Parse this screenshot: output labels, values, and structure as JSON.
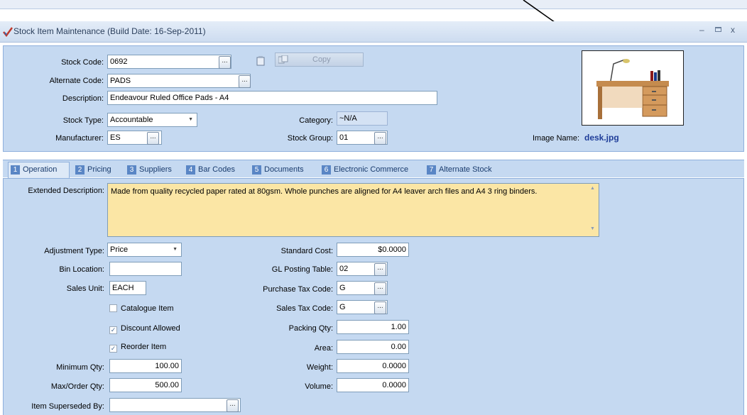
{
  "window": {
    "title": "Stock Item Maintenance (Build Date: 16-Sep-2011)"
  },
  "header": {
    "stock_code_label": "Stock Code:",
    "stock_code": "0692",
    "copy_label": "Copy",
    "alternate_code_label": "Alternate Code:",
    "alternate_code": "PADS",
    "description_label": "Description:",
    "description": "Endeavour Ruled Office Pads - A4",
    "stock_type_label": "Stock Type:",
    "stock_type": "Accountable",
    "category_label": "Category:",
    "category": "~N/A",
    "manufacturer_label": "Manufacturer:",
    "manufacturer": "ES",
    "stock_group_label": "Stock Group:",
    "stock_group": "01",
    "image_name_label": "Image Name:",
    "image_name": "desk.jpg",
    "ellipsis": "..."
  },
  "tabs": [
    {
      "num": "1",
      "label": "Operation"
    },
    {
      "num": "2",
      "label": "Pricing"
    },
    {
      "num": "3",
      "label": "Suppliers"
    },
    {
      "num": "4",
      "label": "Bar Codes"
    },
    {
      "num": "5",
      "label": "Documents"
    },
    {
      "num": "6",
      "label": "Electronic Commerce"
    },
    {
      "num": "7",
      "label": "Alternate Stock"
    }
  ],
  "operation": {
    "ext_desc_label": "Extended Description:",
    "ext_desc": "Made from quality recycled paper rated at 80gsm. Whole punches are aligned for A4 leaver arch files and A4 3 ring binders.",
    "adj_type_label": "Adjustment Type:",
    "adj_type": "Price",
    "bin_location_label": "Bin Location:",
    "bin_location": "",
    "sales_unit_label": "Sales Unit:",
    "sales_unit": "EACH",
    "catalogue_item_label": "Catalogue Item",
    "catalogue_item_checked": false,
    "discount_allowed_label": "Discount Allowed",
    "discount_allowed_checked": true,
    "reorder_item_label": "Reorder Item",
    "reorder_item_checked": true,
    "min_qty_label": "Minimum Qty:",
    "min_qty": "100.00",
    "max_qty_label": "Max/Order Qty:",
    "max_qty": "500.00",
    "superseded_label": "Item Superseded By:",
    "superseded": "",
    "std_cost_label": "Standard Cost:",
    "std_cost": "$0.0000",
    "gl_posting_label": "GL Posting Table:",
    "gl_posting": "02",
    "purchase_tax_label": "Purchase Tax Code:",
    "purchase_tax": "G",
    "sales_tax_label": "Sales Tax Code:",
    "sales_tax": "G",
    "packing_qty_label": "Packing Qty:",
    "packing_qty": "1.00",
    "area_label": "Area:",
    "area": "0.00",
    "weight_label": "Weight:",
    "weight": "0.0000",
    "volume_label": "Volume:",
    "volume": "0.0000"
  },
  "colors": {
    "panel": "#c5d9f1",
    "titlebar": "#d6e3f3",
    "ext_desc_bg": "#fbe6a5",
    "image_name": "#1f3d99"
  },
  "icons": {
    "app": "checkmark-icon",
    "copy": "copy-icon",
    "clipboard": "clipboard-icon",
    "annotation": "arrow-icon"
  }
}
